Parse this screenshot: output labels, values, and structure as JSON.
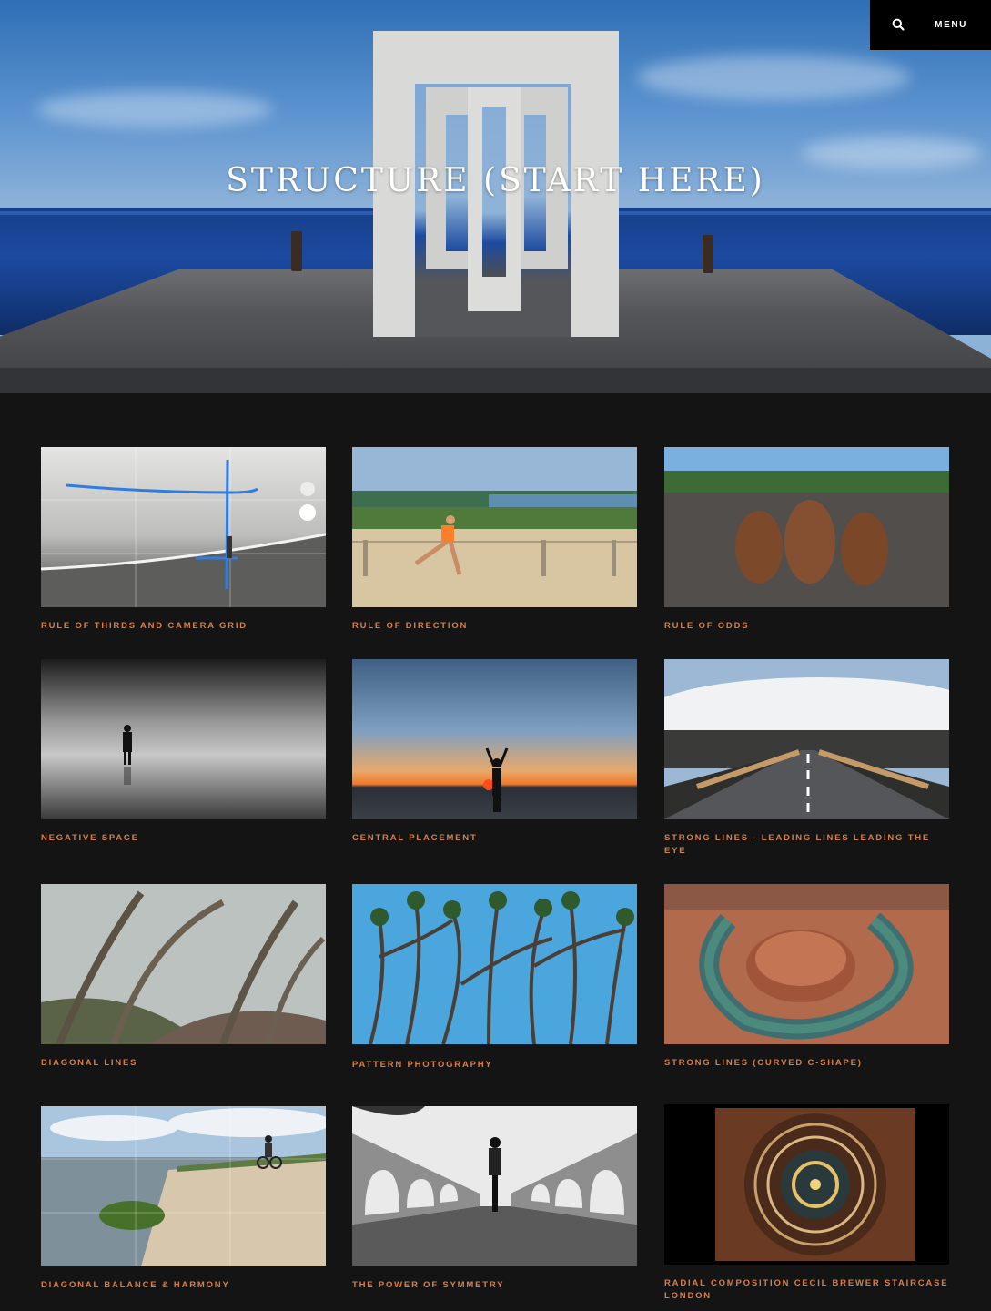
{
  "header": {
    "title": "STRUCTURE (START HERE)",
    "menu_label": "MENU",
    "search_icon": "search-icon"
  },
  "colors": {
    "background": "#141414",
    "caption_accent": "#d8804a",
    "topbar": "#000000"
  },
  "cards": [
    {
      "caption": "RULE OF THIRDS AND CAMERA GRID",
      "image": "beach with camera grid overlay"
    },
    {
      "caption": "RULE OF DIRECTION",
      "image": "runner on sandy dune"
    },
    {
      "caption": "RULE OF ODDS",
      "image": "three pine cones on volcanic ground"
    },
    {
      "caption": "NEGATIVE SPACE",
      "image": "lone figure in fog"
    },
    {
      "caption": "CENTRAL PLACEMENT",
      "image": "person at sunset on beach"
    },
    {
      "caption": "STRONG LINES - LEADING LINES LEADING THE EYE",
      "image": "road leading into clouds"
    },
    {
      "caption": "DIAGONAL LINES",
      "image": "twisted forest trees"
    },
    {
      "caption": "PATTERN PHOTOGRAPHY",
      "image": "dragon trees against blue sky"
    },
    {
      "caption": "STRONG LINES (CURVED C-SHAPE)",
      "image": "horseshoe bend canyon"
    },
    {
      "caption": "DIAGONAL BALANCE & HARMONY",
      "image": "mossy rock on beach with cyclist"
    },
    {
      "caption": "THE POWER OF SYMMETRY",
      "image": "cyclist on bridge"
    },
    {
      "caption": "RADIAL COMPOSITION CECIL BREWER STAIRCASE LONDON",
      "image": "spiral staircase from above"
    }
  ]
}
